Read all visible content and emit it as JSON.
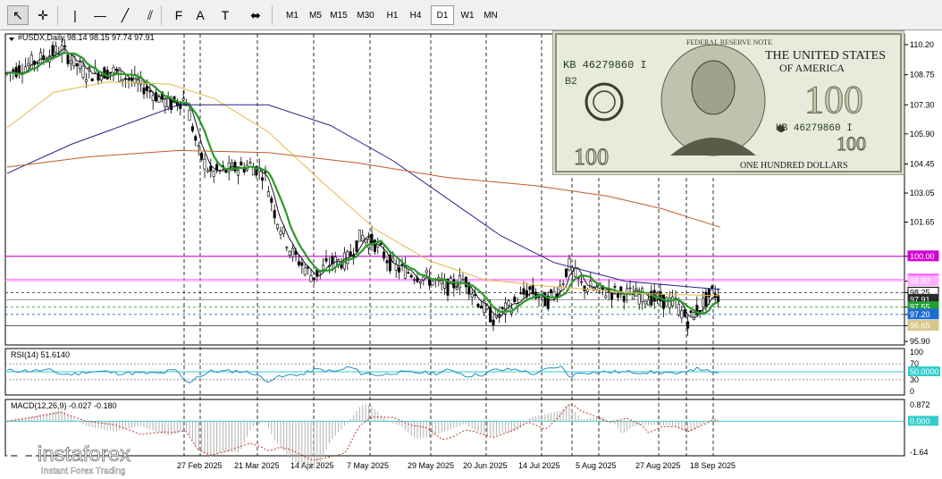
{
  "toolbar": {
    "tools": [
      {
        "name": "cursor-arrow-icon",
        "glyph": "↖"
      },
      {
        "name": "crosshair-icon",
        "glyph": "✛"
      },
      {
        "name": "vertical-line-icon",
        "glyph": "|"
      },
      {
        "name": "horizontal-line-icon",
        "glyph": "—"
      },
      {
        "name": "trendline-icon",
        "glyph": "╱"
      },
      {
        "name": "channel-icon",
        "glyph": "⫽"
      },
      {
        "name": "fibonacci-icon",
        "glyph": "F"
      },
      {
        "name": "text-icon",
        "glyph": "A"
      },
      {
        "name": "text-label-icon",
        "glyph": "T"
      },
      {
        "name": "shapes-icon",
        "glyph": "⬌"
      }
    ],
    "timeframes": [
      "M1",
      "M5",
      "M15",
      "M30",
      "H1",
      "H4",
      "D1",
      "W1",
      "MN"
    ],
    "active_timeframe": "D1"
  },
  "chart": {
    "header": "#USDX,Daily  98.14 98.15 97.74 97.91",
    "price_axis": [
      "110.20",
      "108.75",
      "107.30",
      "105.90",
      "104.45",
      "103.05",
      "101.65",
      "100.00",
      "98.80",
      "98.25",
      "97.55",
      "97.20",
      "96.65",
      "95.90"
    ],
    "price_tags": [
      {
        "text": "100.00",
        "bg": "#d400d4",
        "fg": "#ffffff"
      },
      {
        "text": "98.88",
        "bg": "#ff4dff",
        "fg": "#ffffff"
      },
      {
        "text": "98.80",
        "bg": "#ffb0ff",
        "fg": "#ffffff"
      },
      {
        "text": "98.25",
        "bg": "#ffffff",
        "fg": "#000000"
      },
      {
        "text": "97.91",
        "bg": "#2a2a2a",
        "fg": "#ffffff"
      },
      {
        "text": "97.55",
        "bg": "#22a033",
        "fg": "#ffffff"
      },
      {
        "text": "97.20",
        "bg": "#1f6cd0",
        "fg": "#ffffff"
      },
      {
        "text": "96.65",
        "bg": "#d7c68a",
        "fg": "#ffffff"
      }
    ],
    "date_axis": [
      "27 Feb 2025",
      "21 Mar 2025",
      "14 Apr 2025",
      "7 May 2025",
      "29 May 2025",
      "20 Jun 2025",
      "14 Jul 2025",
      "5 Aug 2025",
      "27 Aug 2025",
      "18 Sep 2025"
    ],
    "colors": {
      "ma_fast": "#1a1a1a",
      "ma_green": "#2a9a2a",
      "ma_orange": "#e8b84a",
      "ma_blue": "#23238c",
      "ma_brown": "#c15b2a",
      "level_magenta": "#d400d4"
    }
  },
  "rsi": {
    "label": "RSI(14) 51.6140",
    "axis": [
      "100",
      "70",
      "30",
      "0"
    ],
    "tag": "50.0000",
    "tag_color": "#33cccc"
  },
  "macd": {
    "label": "MACD(12,26,9) -0.027 -0.180",
    "axis": [
      "0.872",
      "-1.64"
    ],
    "tag": "0.000",
    "tag_color": "#33cccc"
  },
  "banknote": {
    "serial_top": "KB 46279860 I",
    "serial_bottom": "KB 46279860 I",
    "block": "B2",
    "top_text": "FEDERAL RESERVE NOTE",
    "country_line1": "THE UNITED STATES",
    "country_line2": "OF AMERICA",
    "denomination": "100",
    "bottom_text": "ONE HUNDRED DOLLARS"
  },
  "watermark": {
    "brand": "instaforex",
    "tagline": "Instant Forex Trading"
  }
}
